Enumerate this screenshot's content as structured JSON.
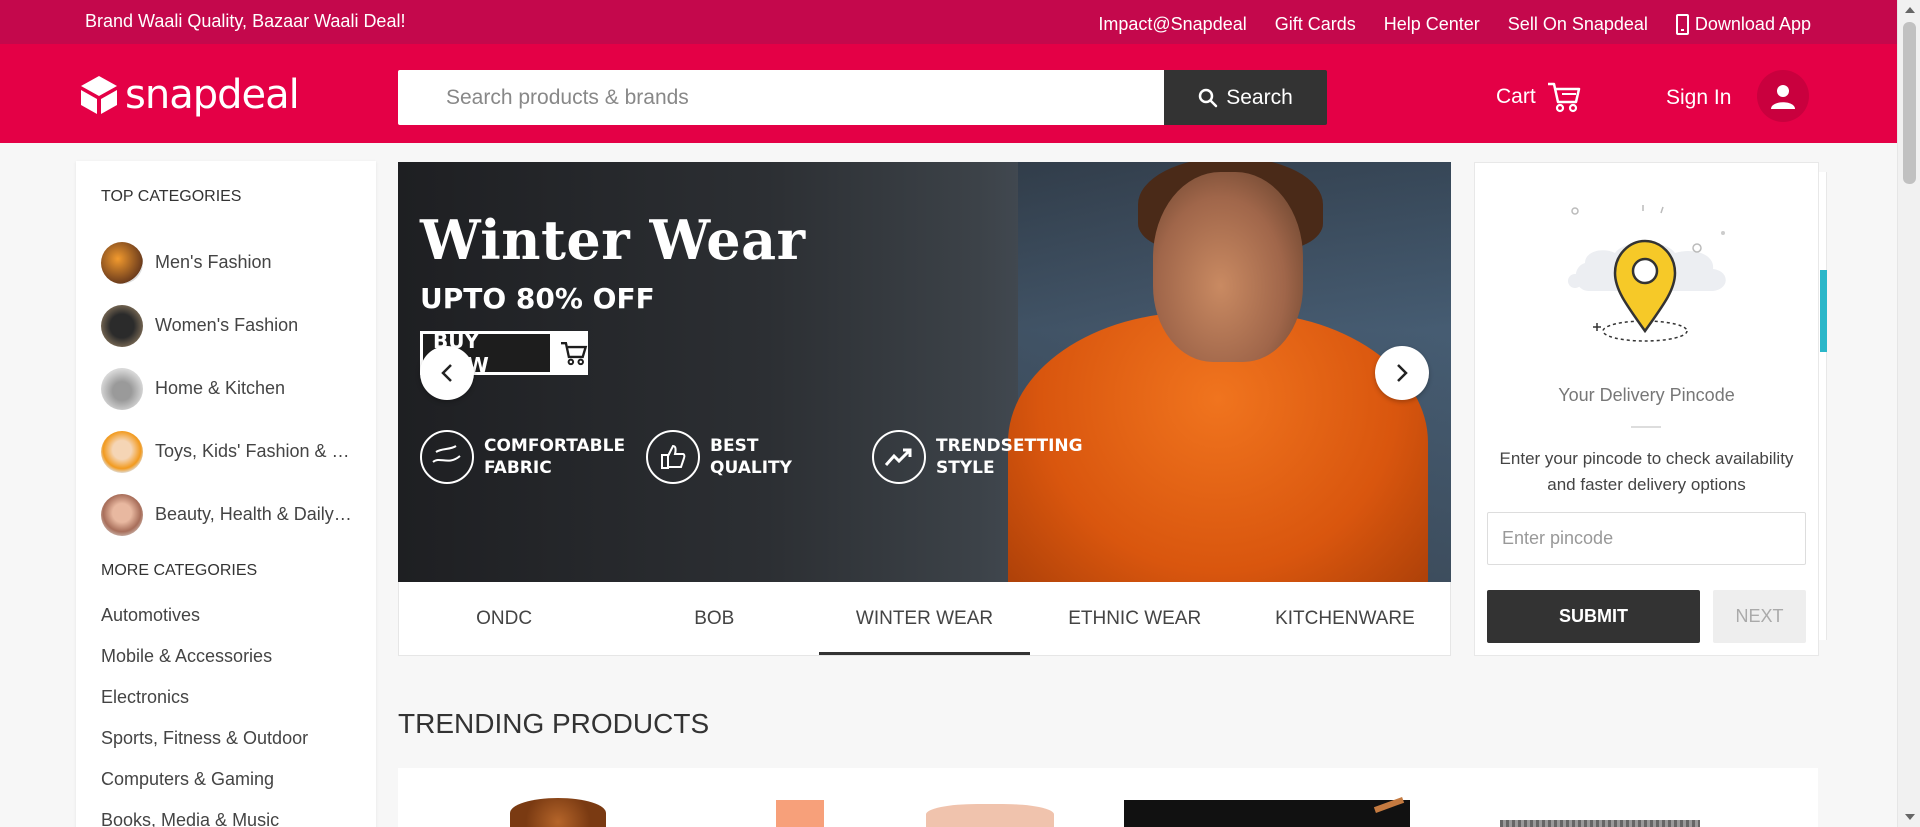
{
  "topbar": {
    "tagline": "Brand Waali Quality, Bazaar Waali Deal!",
    "links": [
      "Impact@Snapdeal",
      "Gift Cards",
      "Help Center",
      "Sell On Snapdeal",
      "Download App"
    ]
  },
  "header": {
    "logo_text": "snapdeal",
    "search_placeholder": "Search products & brands",
    "search_button": "Search",
    "cart_label": "Cart",
    "signin_label": "Sign In"
  },
  "sidebar": {
    "top_heading": "TOP CATEGORIES",
    "top_categories": [
      {
        "label": "Men's Fashion"
      },
      {
        "label": "Women's Fashion"
      },
      {
        "label": "Home & Kitchen"
      },
      {
        "label": "Toys, Kids' Fashion & more"
      },
      {
        "label": "Beauty, Health & Daily Needs"
      }
    ],
    "more_heading": "MORE CATEGORIES",
    "more_categories": [
      "Automotives",
      "Mobile & Accessories",
      "Electronics",
      "Sports, Fitness & Outdoor",
      "Computers & Gaming",
      "Books, Media & Music"
    ]
  },
  "banner": {
    "title": "Winter Wear",
    "subtitle": "UPTO 80% OFF",
    "cta": "BUY NOW",
    "features": [
      {
        "text": "COMFORTABLE\nFABRIC"
      },
      {
        "text": "BEST\nQUALITY"
      },
      {
        "text": "TRENDSETTING\nSTYLE"
      }
    ],
    "tabs": [
      "ONDC",
      "BOB",
      "WINTER WEAR",
      "ETHNIC WEAR",
      "KITCHENWARE"
    ],
    "active_tab": "WINTER WEAR"
  },
  "pincode": {
    "title": "Your Delivery Pincode",
    "description": "Enter your pincode to check availability and faster delivery options",
    "input_placeholder": "Enter pincode",
    "submit_label": "SUBMIT",
    "next_label": "NEXT"
  },
  "trending": {
    "title": "TRENDING PRODUCTS"
  },
  "colors": {
    "brand_red": "#e40046",
    "topbar_red": "#c4084c",
    "dark": "#333333"
  }
}
